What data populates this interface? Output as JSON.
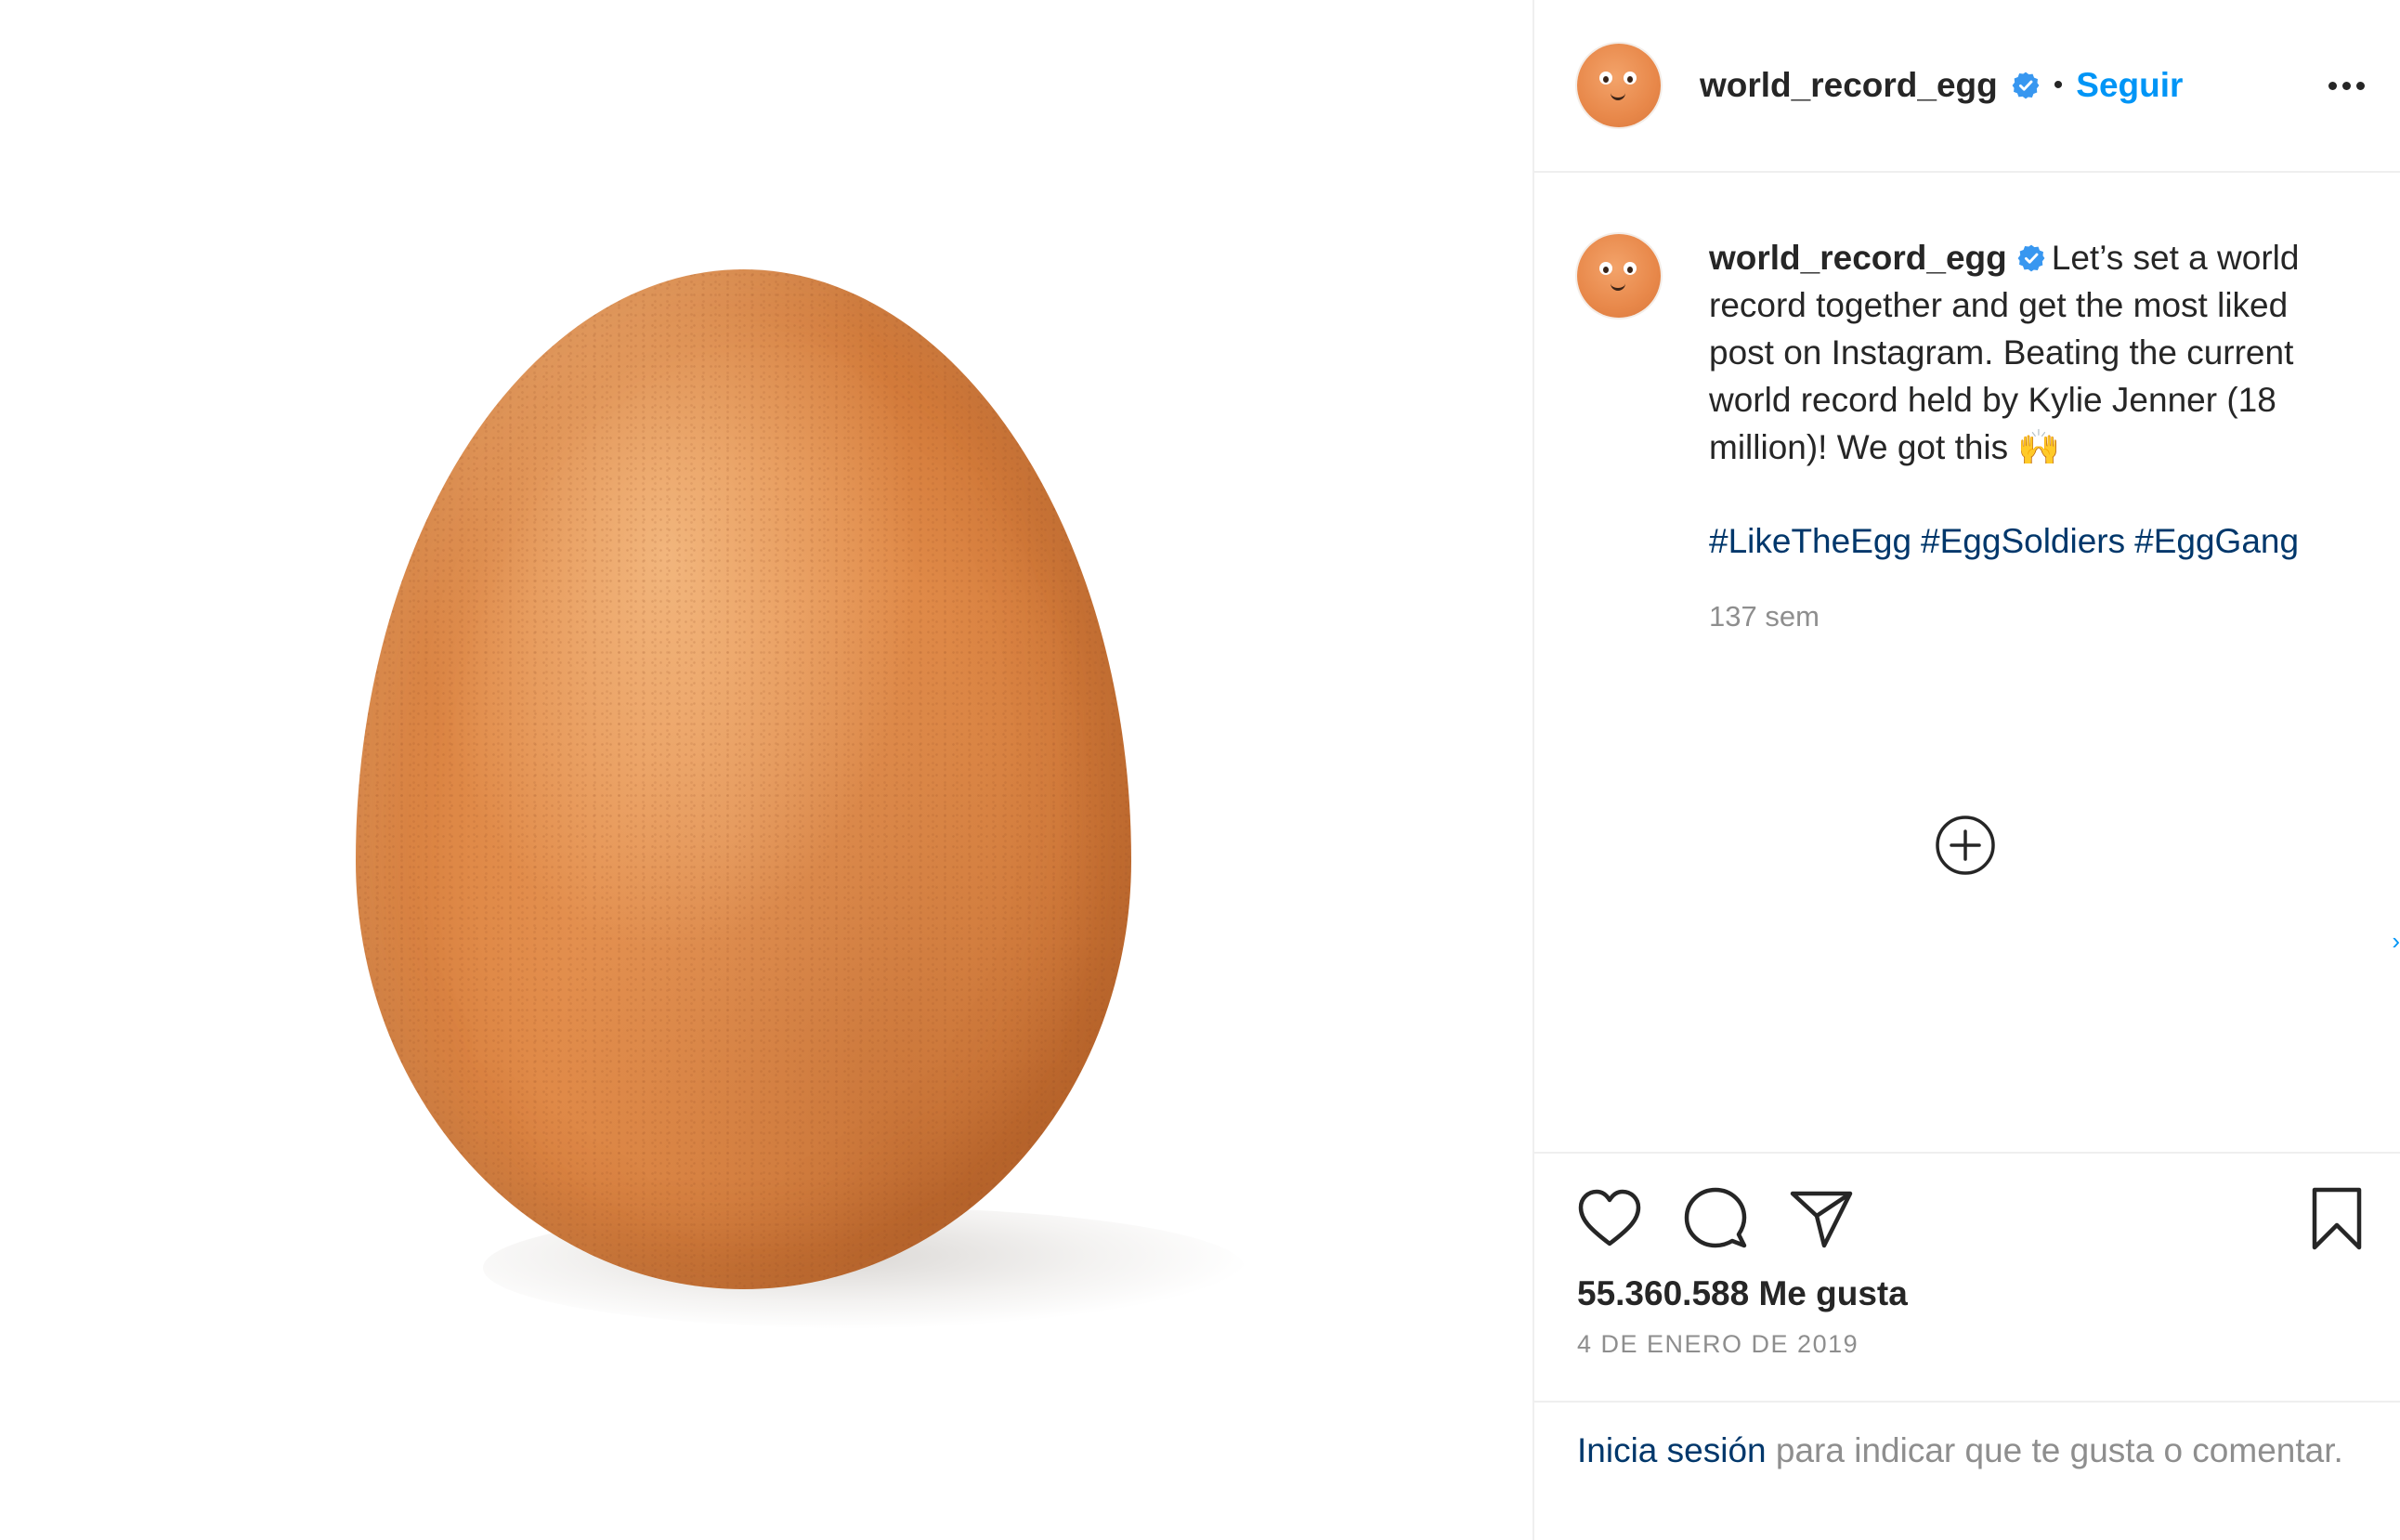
{
  "post": {
    "image_alt_subject": "egg",
    "header": {
      "username": "world_record_egg",
      "separator": "•",
      "follow_label": "Seguir"
    },
    "caption": {
      "username": "world_record_egg",
      "text": "Let’s set a world record together and get the most liked post on Instagram. Beating the current world record held by Kylie Jenner (18 million)! We got this 🙌",
      "hashtags": [
        "#LikeTheEgg",
        "#EggSoldiers",
        "#EggGang"
      ],
      "time_ago": "137 sem"
    },
    "likes_text": "55.360.588 Me gusta",
    "date_text": "4 DE ENERO DE 2019",
    "login_prompt": {
      "link_label": "Inicia sesión",
      "rest_text": " para indicar que te gusta o comentar."
    }
  },
  "icons": {
    "verified": "verified-badge-icon",
    "more": "more-options-icon",
    "load_more": "plus-circle-icon",
    "like": "heart-icon",
    "comment": "comment-bubble-icon",
    "share": "paper-plane-icon",
    "save": "bookmark-icon"
  },
  "colors": {
    "link_blue": "#0095f6",
    "hashtag_blue": "#00376b",
    "muted_gray": "#8e8e8e",
    "text": "#262626",
    "egg": "#e08a48"
  }
}
